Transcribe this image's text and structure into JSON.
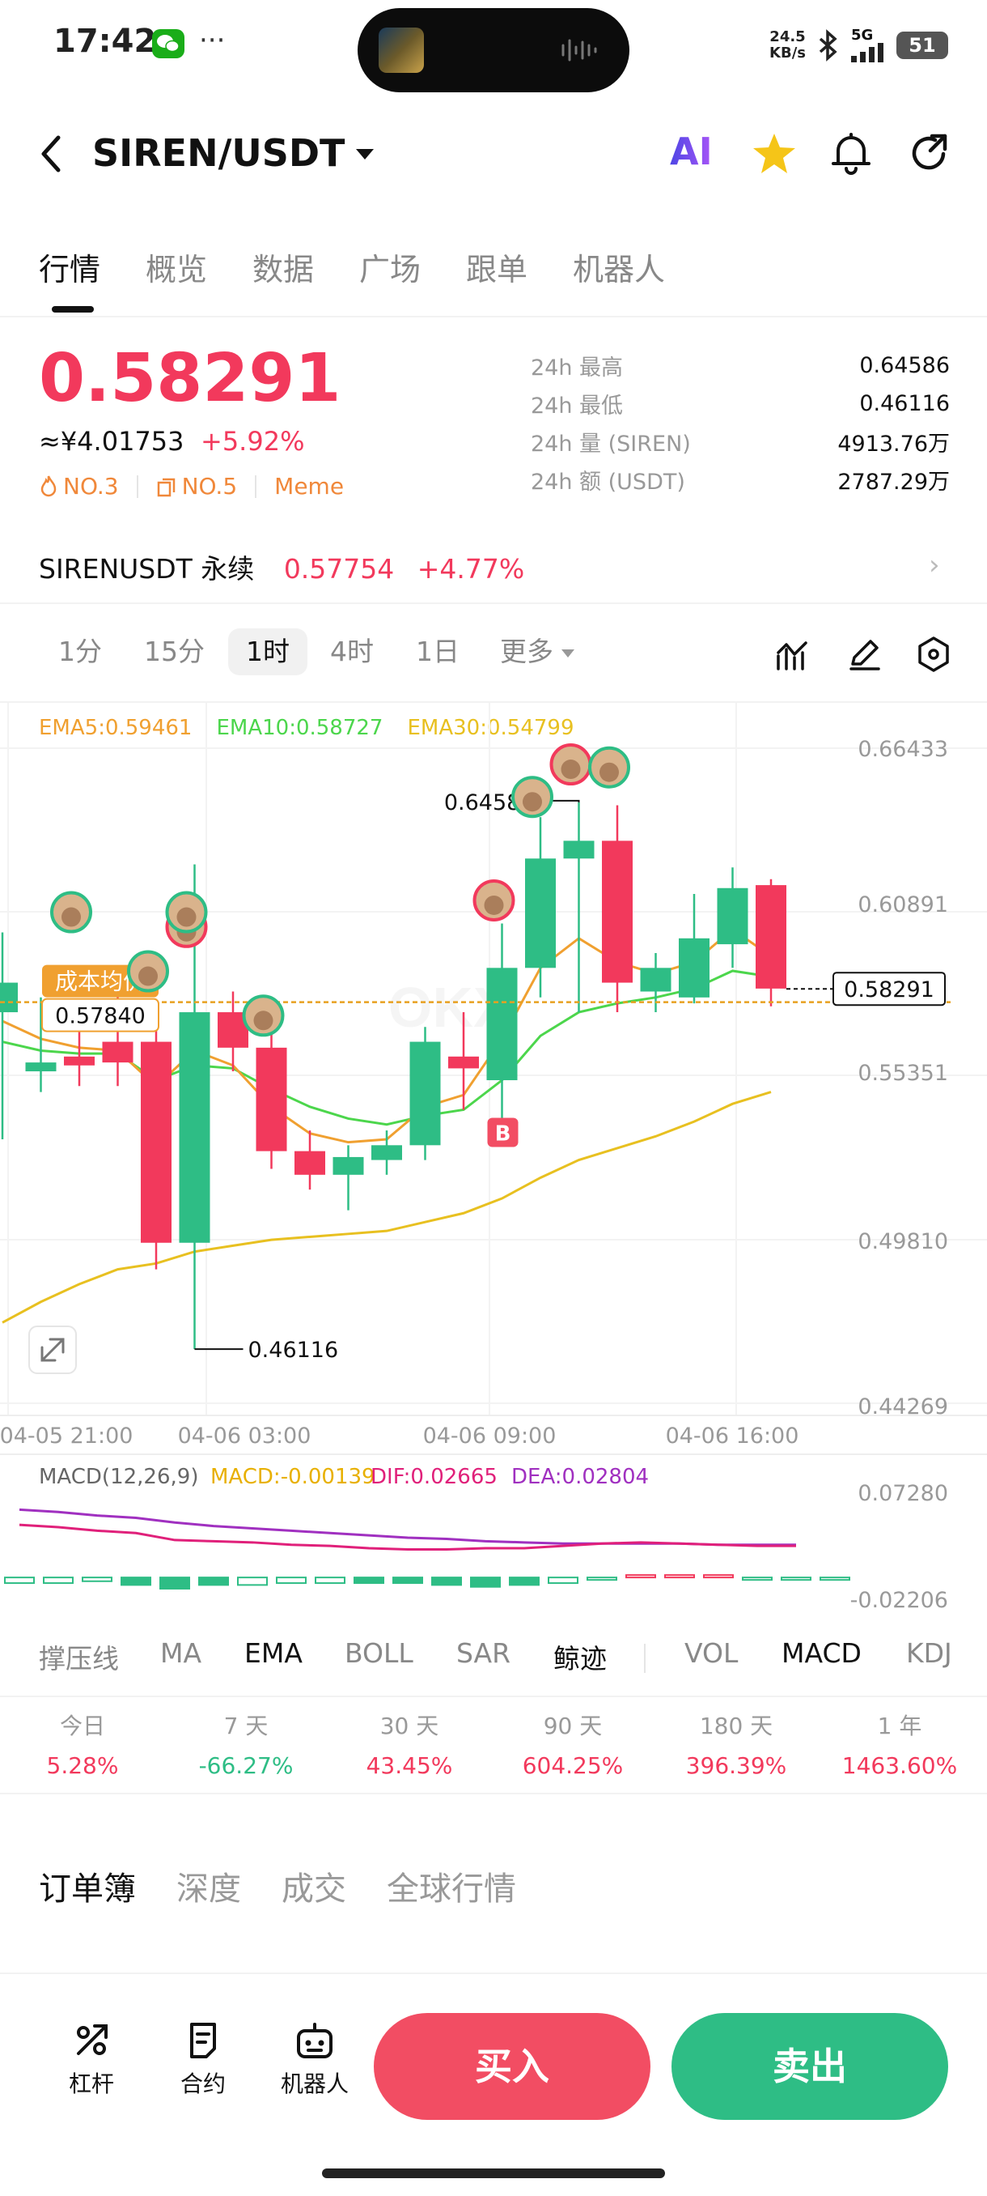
{
  "status_bar": {
    "time": "17:42",
    "net_speed_value": "24.5",
    "net_speed_unit": "KB/s",
    "signal": "5G",
    "battery": "51"
  },
  "header": {
    "pair": "SIREN/USDT",
    "ai_label": "AI"
  },
  "tabs": [
    "行情",
    "概览",
    "数据",
    "广场",
    "跟单",
    "机器人"
  ],
  "ticker": {
    "price": "0.58291",
    "cny": "≈¥4.01753",
    "change": "+5.92%",
    "rank1": "NO.3",
    "rank2": "NO.5",
    "category": "Meme",
    "stats": [
      {
        "label": "24h  最高",
        "value": "0.64586"
      },
      {
        "label": "24h  最低",
        "value": "0.46116"
      },
      {
        "label": "24h  量 (SIREN)",
        "value": "4913.76万"
      },
      {
        "label": "24h  额 (USDT)",
        "value": "2787.29万"
      }
    ]
  },
  "perpetual": {
    "name": "SIRENUSDT 永续",
    "price": "0.57754",
    "change": "+4.77%"
  },
  "intervals": [
    "1分",
    "15分",
    "1时",
    "4时",
    "1日",
    "更多"
  ],
  "chart": {
    "ema_legend": [
      {
        "text": "EMA5:0.59461",
        "color": "#f0a030"
      },
      {
        "text": "EMA10:0.58727",
        "color": "#4cd64c"
      },
      {
        "text": "EMA30:0.54799",
        "color": "#e8c020"
      }
    ],
    "price_axis": [
      "0.66433",
      "0.60891",
      "0.55351",
      "0.49810",
      "0.44269"
    ],
    "time_axis": [
      "04-05 21:00",
      "04-06 03:00",
      "04-06 09:00",
      "04-06 16:00"
    ],
    "high_label": "0.64586",
    "low_label": "0.46116",
    "current_price": "0.58291",
    "cost_label": "成本均价",
    "cost_value": "0.57840",
    "buy_marker": "B",
    "macd_legend": [
      {
        "text": "MACD(12,26,9)",
        "color": "#666666"
      },
      {
        "text": "MACD:-0.00139",
        "color": "#e8b000"
      },
      {
        "text": "DIF:0.02665",
        "color": "#e0207a"
      },
      {
        "text": "DEA:0.02804",
        "color": "#a030c0"
      }
    ],
    "macd_axis": [
      "0.07280",
      "-0.02206"
    ]
  },
  "chart_data": {
    "type": "candlestick",
    "candles": [
      {
        "o": 0.575,
        "c": 0.585,
        "h": 0.602,
        "l": 0.532
      },
      {
        "o": 0.555,
        "c": 0.558,
        "h": 0.58,
        "l": 0.548
      },
      {
        "o": 0.56,
        "c": 0.557,
        "h": 0.578,
        "l": 0.55
      },
      {
        "o": 0.565,
        "c": 0.558,
        "h": 0.585,
        "l": 0.55
      },
      {
        "o": 0.565,
        "c": 0.497,
        "h": 0.57,
        "l": 0.488
      },
      {
        "o": 0.497,
        "c": 0.575,
        "h": 0.625,
        "l": 0.461
      },
      {
        "o": 0.575,
        "c": 0.563,
        "h": 0.582,
        "l": 0.555
      },
      {
        "o": 0.563,
        "c": 0.528,
        "h": 0.572,
        "l": 0.522
      },
      {
        "o": 0.528,
        "c": 0.52,
        "h": 0.535,
        "l": 0.515
      },
      {
        "o": 0.52,
        "c": 0.526,
        "h": 0.53,
        "l": 0.508
      },
      {
        "o": 0.525,
        "c": 0.53,
        "h": 0.535,
        "l": 0.52
      },
      {
        "o": 0.53,
        "c": 0.565,
        "h": 0.57,
        "l": 0.525
      },
      {
        "o": 0.56,
        "c": 0.556,
        "h": 0.575,
        "l": 0.542
      },
      {
        "o": 0.552,
        "c": 0.59,
        "h": 0.605,
        "l": 0.538
      },
      {
        "o": 0.59,
        "c": 0.627,
        "h": 0.641,
        "l": 0.58
      },
      {
        "o": 0.627,
        "c": 0.633,
        "h": 0.646,
        "l": 0.575
      },
      {
        "o": 0.633,
        "c": 0.585,
        "h": 0.645,
        "l": 0.575
      },
      {
        "o": 0.582,
        "c": 0.59,
        "h": 0.595,
        "l": 0.575
      },
      {
        "o": 0.58,
        "c": 0.6,
        "h": 0.615,
        "l": 0.578
      },
      {
        "o": 0.598,
        "c": 0.617,
        "h": 0.624,
        "l": 0.59
      },
      {
        "o": 0.618,
        "c": 0.583,
        "h": 0.62,
        "l": 0.577
      }
    ],
    "ema5": [
      0.572,
      0.566,
      0.563,
      0.562,
      0.55,
      0.562,
      0.557,
      0.543,
      0.534,
      0.531,
      0.532,
      0.543,
      0.547,
      0.566,
      0.59,
      0.6,
      0.592,
      0.588,
      0.592,
      0.603,
      0.594
    ],
    "ema10": [
      0.565,
      0.562,
      0.561,
      0.561,
      0.552,
      0.557,
      0.556,
      0.549,
      0.543,
      0.539,
      0.537,
      0.54,
      0.542,
      0.552,
      0.567,
      0.575,
      0.578,
      0.58,
      0.583,
      0.589,
      0.587
    ],
    "ema30": [
      0.47,
      0.477,
      0.483,
      0.488,
      0.49,
      0.494,
      0.496,
      0.498,
      0.499,
      0.5,
      0.501,
      0.504,
      0.507,
      0.512,
      0.519,
      0.525,
      0.529,
      0.533,
      0.538,
      0.544,
      0.548
    ],
    "ylim": [
      0.44269,
      0.66433
    ],
    "macd_hist": [
      -0.003,
      -0.003,
      -0.002,
      -0.004,
      -0.006,
      -0.004,
      -0.004,
      -0.003,
      -0.003,
      -0.003,
      -0.003,
      -0.004,
      -0.005,
      -0.004,
      -0.003,
      -0.001,
      0.001,
      0.001,
      0.001,
      -0.001,
      -0.001,
      -0.001
    ],
    "macd_dif": [
      0.045,
      0.043,
      0.04,
      0.038,
      0.032,
      0.031,
      0.03,
      0.028,
      0.027,
      0.025,
      0.024,
      0.024,
      0.025,
      0.025,
      0.027,
      0.029,
      0.03,
      0.029,
      0.028,
      0.027,
      0.027
    ],
    "macd_dea": [
      0.058,
      0.056,
      0.053,
      0.051,
      0.047,
      0.044,
      0.042,
      0.04,
      0.038,
      0.036,
      0.034,
      0.033,
      0.031,
      0.03,
      0.029,
      0.029,
      0.029,
      0.029,
      0.028,
      0.028,
      0.028
    ],
    "macd_ylim": [
      -0.02206,
      0.0728
    ]
  },
  "indicators": [
    "撑压线",
    "MA",
    "EMA",
    "BOLL",
    "SAR",
    "鲸迹",
    "VOL",
    "MACD",
    "KDJ"
  ],
  "performance": [
    {
      "label": "今日",
      "value": "5.28%",
      "color": "#f2395c"
    },
    {
      "label": "7 天",
      "value": "-66.27%",
      "color": "#2ebd85"
    },
    {
      "label": "30 天",
      "value": "43.45%",
      "color": "#f2395c"
    },
    {
      "label": "90 天",
      "value": "604.25%",
      "color": "#f2395c"
    },
    {
      "label": "180 天",
      "value": "396.39%",
      "color": "#f2395c"
    },
    {
      "label": "1 年",
      "value": "1463.60%",
      "color": "#f2395c"
    }
  ],
  "orderbook_tabs": [
    "订单簿",
    "深度",
    "成交",
    "全球行情"
  ],
  "bottom_bar": {
    "leverage": "杠杆",
    "contract": "合约",
    "bot": "机器人",
    "buy": "买入",
    "sell": "卖出"
  },
  "colors": {
    "up": "#f2395c",
    "down": "#2ebd85",
    "accent": "#f0883a"
  }
}
